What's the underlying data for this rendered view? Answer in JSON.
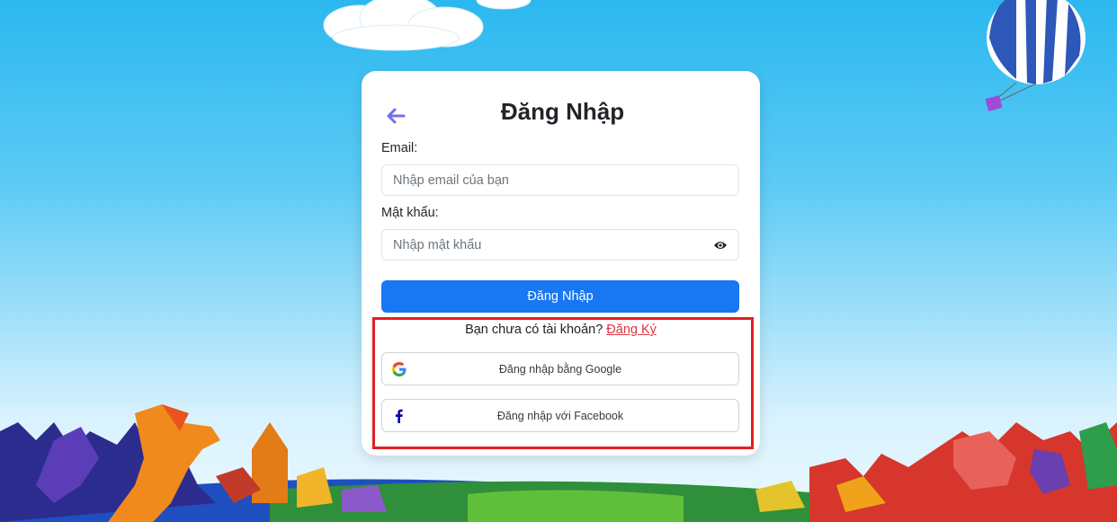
{
  "login": {
    "title": "Đăng Nhập",
    "email_label": "Email:",
    "email_placeholder": "Nhập email của bạn",
    "email_value": "",
    "password_label": "Mật khẩu:",
    "password_placeholder": "Nhập mật khẩu",
    "password_value": "",
    "submit_label": "Đăng Nhập",
    "no_account_text": "Bạn chưa có tài khoản?",
    "signup_link": "Đăng Ký",
    "google_button": "Đăng nhập bằng Google",
    "facebook_button": "Đăng nhập với Facebook"
  },
  "icons": {
    "back": "arrow-left-icon",
    "toggle_password": "eye-icon",
    "google": "google-icon",
    "facebook": "facebook-icon"
  },
  "colors": {
    "accent": "#1877f2",
    "back_arrow": "#6f6ff0",
    "signup_link": "#dc3545",
    "highlight_box": "#e02020"
  }
}
